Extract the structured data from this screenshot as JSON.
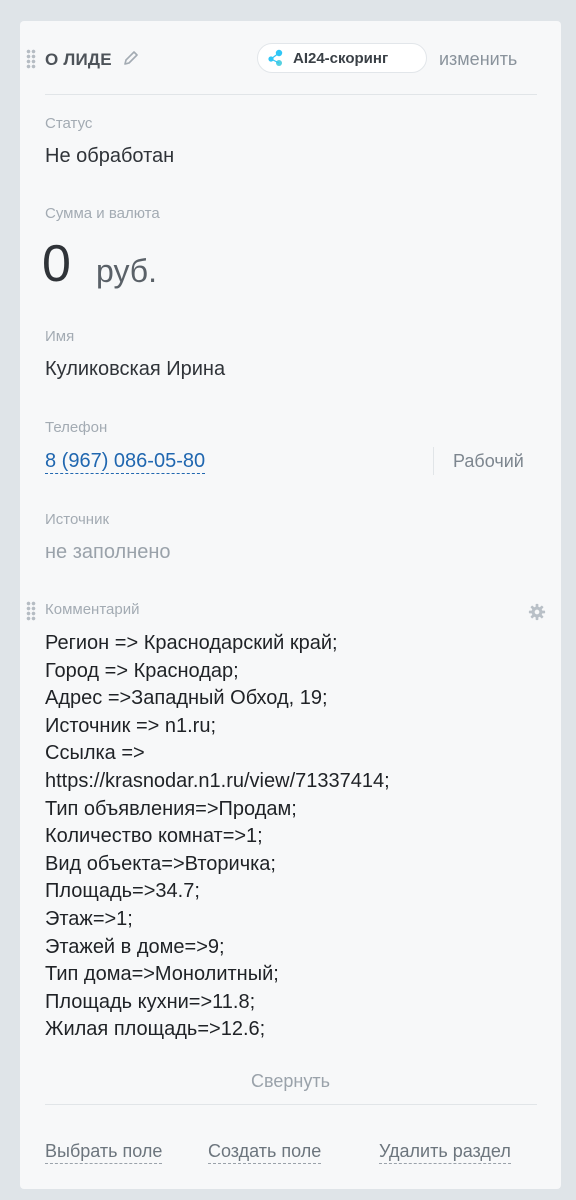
{
  "header": {
    "title": "О ЛИДЕ",
    "ai_badge_label": "AI24-скоринг",
    "change_label": "изменить"
  },
  "fields": {
    "status": {
      "label": "Статус",
      "value": "Не обработан"
    },
    "amount": {
      "label": "Сумма и валюта",
      "value": "0",
      "currency": "руб."
    },
    "name": {
      "label": "Имя",
      "value": "Куликовская Ирина"
    },
    "phone": {
      "label": "Телефон",
      "value": "8 (967) 086-05-80",
      "type": "Рабочий"
    },
    "source": {
      "label": "Источник",
      "value": "не заполнено"
    }
  },
  "comment": {
    "label": "Комментарий",
    "lines": [
      "Регион => Краснодарский край;",
      "Город => Краснодар;",
      "Адрес =>Западный Обход, 19;",
      "Источник => n1.ru;",
      "Ссылка =>",
      "https://krasnodar.n1.ru/view/71337414;",
      "Тип объявления=>Продам;",
      "Количество комнат=>1;",
      "Вид объекта=>Вторичка;",
      "Площадь=>34.7;",
      "Этаж=>1;",
      "Этажей в доме=>9;",
      "Тип дома=>Монолитный;",
      "Площадь кухни=>11.8;",
      "Жилая площадь=>12.6;"
    ],
    "collapse_label": "Свернуть"
  },
  "footer": {
    "select_field": "Выбрать поле",
    "create_field": "Создать поле",
    "delete_section": "Удалить раздел"
  },
  "colors": {
    "link": "#2067b0",
    "ai_icon": "#2fc6f6"
  }
}
